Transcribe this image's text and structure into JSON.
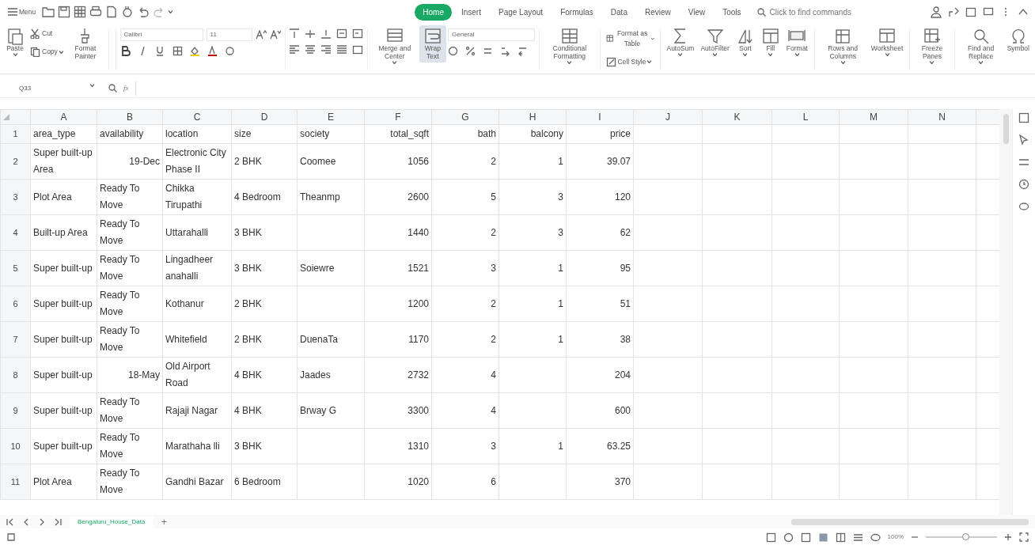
{
  "menu": {
    "label": "Menu"
  },
  "tabs": [
    {
      "label": "Home",
      "selected": true
    },
    {
      "label": "Insert",
      "selected": false
    },
    {
      "label": "Page Layout",
      "selected": false
    },
    {
      "label": "Formulas",
      "selected": false
    },
    {
      "label": "Data",
      "selected": false
    },
    {
      "label": "Review",
      "selected": false
    },
    {
      "label": "View",
      "selected": false
    },
    {
      "label": "Tools",
      "selected": false
    }
  ],
  "search": {
    "placeholder": "Click to find commands"
  },
  "ribbon": [
    {
      "kind": "big",
      "label": "Paste",
      "menu": true,
      "on": false
    },
    {
      "kind": "stack",
      "items": [
        {
          "label": "Cut",
          "menu": false
        },
        {
          "label": "Copy",
          "menu": true
        }
      ]
    },
    {
      "kind": "big",
      "label": "Format Painter",
      "menu": false,
      "on": false
    },
    {
      "kind": "font",
      "font": "Calibri",
      "size": "11"
    },
    {
      "kind": "align"
    },
    {
      "kind": "big",
      "label": "Merge and Center",
      "menu": true,
      "on": false
    },
    {
      "kind": "big",
      "label": "Wrap Text",
      "menu": false,
      "on": true
    },
    {
      "kind": "number",
      "format": "General"
    },
    {
      "kind": "big",
      "label": "Conditional Formatting",
      "menu": true,
      "on": false
    },
    {
      "kind": "stack",
      "items": [
        {
          "label": "Format as Table",
          "menu": true
        },
        {
          "label": "Cell Style",
          "menu": true
        }
      ]
    },
    {
      "kind": "big",
      "label": "AutoSum",
      "menu": true,
      "on": false
    },
    {
      "kind": "big",
      "label": "AutoFilter",
      "menu": true,
      "on": false
    },
    {
      "kind": "big",
      "label": "Sort",
      "menu": true,
      "on": false
    },
    {
      "kind": "big",
      "label": "Fill",
      "menu": true,
      "on": false
    },
    {
      "kind": "big",
      "label": "Format",
      "menu": true,
      "on": false
    },
    {
      "kind": "big",
      "label": "Rows and Columns",
      "menu": true,
      "on": false
    },
    {
      "kind": "big",
      "label": "Worksheet",
      "menu": true,
      "on": false
    },
    {
      "kind": "big",
      "label": "Freeze Panes",
      "menu": true,
      "on": false
    },
    {
      "kind": "big",
      "label": "Find and Replace",
      "menu": true,
      "on": false
    },
    {
      "kind": "big",
      "label": "Symbol",
      "menu": false,
      "on": false
    }
  ],
  "formula_bar": {
    "cell_name": "Q33",
    "function_label": "fx"
  },
  "table": {
    "columns": [
      "A",
      "B",
      "C",
      "D",
      "E",
      "F",
      "G",
      "H",
      "I",
      "J",
      "K",
      "L",
      "M",
      "N"
    ],
    "right_aligned": [
      false,
      false,
      false,
      false,
      false,
      true,
      true,
      true,
      true
    ],
    "rows": [
      {
        "number": "1",
        "cells": [
          "area_type",
          "availability",
          "location",
          "size",
          "society",
          "total_sqft",
          "bath",
          "balcony",
          "price"
        ]
      },
      {
        "number": "2",
        "cells": [
          "Super built-up Area",
          {
            "text": "19-Dec",
            "right_aligned": true
          },
          "Electronic City Phase II",
          "2 BHK",
          "Coomee",
          "1056",
          "2",
          "1",
          "39.07"
        ]
      },
      {
        "number": "3",
        "cells": [
          "Plot  Area",
          "Ready To Move",
          "Chikka Tirupathi",
          "4 Bedroom",
          "Theanmp",
          "2600",
          "5",
          "3",
          "120"
        ]
      },
      {
        "number": "4",
        "cells": [
          "Built-up Area",
          "Ready To Move",
          "Uttarahalli",
          "3 BHK",
          null,
          "1440",
          "2",
          "3",
          "62"
        ]
      },
      {
        "number": "5",
        "cells": [
          "Super built-up",
          "Ready To Move",
          "Lingadheer anahalli",
          "3 BHK",
          "Soiewre",
          "1521",
          "3",
          "1",
          "95"
        ]
      },
      {
        "number": "6",
        "cells": [
          "Super built-up",
          "Ready To Move",
          "Kothanur",
          "2 BHK",
          null,
          "1200",
          "2",
          "1",
          "51"
        ]
      },
      {
        "number": "7",
        "cells": [
          "Super built-up",
          "Ready To Move",
          "Whitefield",
          "2 BHK",
          "DuenaTa",
          "1170",
          "2",
          "1",
          "38"
        ]
      },
      {
        "number": "8",
        "cells": [
          "Super built-up",
          {
            "text": "18-May",
            "right_aligned": true
          },
          "Old Airport Road",
          "4 BHK",
          "Jaades",
          "2732",
          "4",
          null,
          "204"
        ]
      },
      {
        "number": "9",
        "cells": [
          "Super built-up",
          "Ready To Move",
          "Rajaji Nagar",
          "4 BHK",
          "Brway G",
          "3300",
          "4",
          null,
          "600"
        ]
      },
      {
        "number": "10",
        "cells": [
          "Super built-up",
          "Ready To Move",
          "Marathaha lli",
          "3 BHK",
          null,
          "1310",
          "3",
          "1",
          "63.25"
        ]
      },
      {
        "number": "11",
        "cells": [
          "Plot  Area",
          "Ready To Move",
          "Gandhi Bazar",
          "6 Bedroom",
          null,
          "1020",
          "6",
          null,
          "370"
        ]
      }
    ]
  },
  "sheet_tabs": [
    {
      "label": "Bengaluru_House_Data",
      "selected": true
    }
  ],
  "add_sheet": "+",
  "status_bar": {
    "zoom": "100%",
    "zoom_slider": {
      "level": 0.55
    }
  }
}
